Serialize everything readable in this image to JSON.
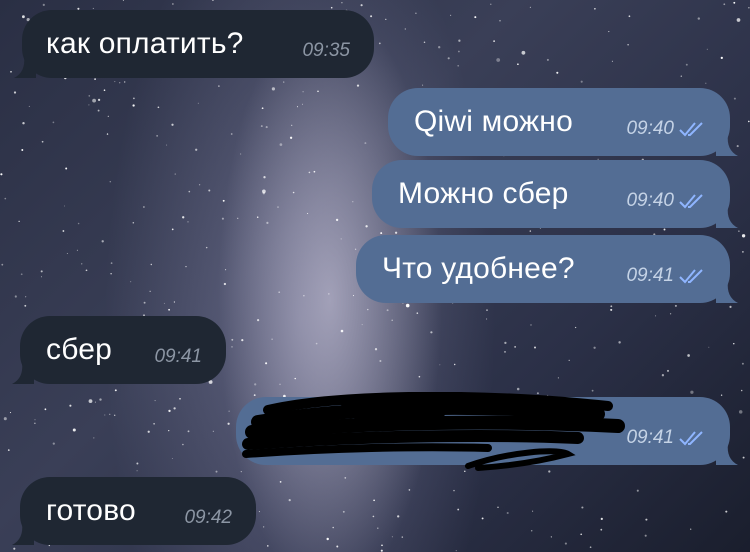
{
  "messages": [
    {
      "direction": "in",
      "text": "как оплатить?",
      "time": "09:35"
    },
    {
      "direction": "out",
      "text": "Qiwi можно",
      "time": "09:40",
      "status": "read"
    },
    {
      "direction": "out",
      "text": "Можно сбер",
      "time": "09:40",
      "status": "read"
    },
    {
      "direction": "out",
      "text": "Что удобнее?",
      "time": "09:41",
      "status": "read"
    },
    {
      "direction": "in",
      "text": "сбер",
      "time": "09:41"
    },
    {
      "direction": "out",
      "text": "",
      "time": "09:41",
      "status": "read",
      "redacted": true
    },
    {
      "direction": "in",
      "text": "готово",
      "time": "09:42"
    }
  ],
  "colors": {
    "incoming_bubble": "#1f2733",
    "outgoing_bubble": "#536d94",
    "read_check": "#8fb5ff"
  },
  "icons": {
    "read_receipt": "double-check-icon"
  }
}
